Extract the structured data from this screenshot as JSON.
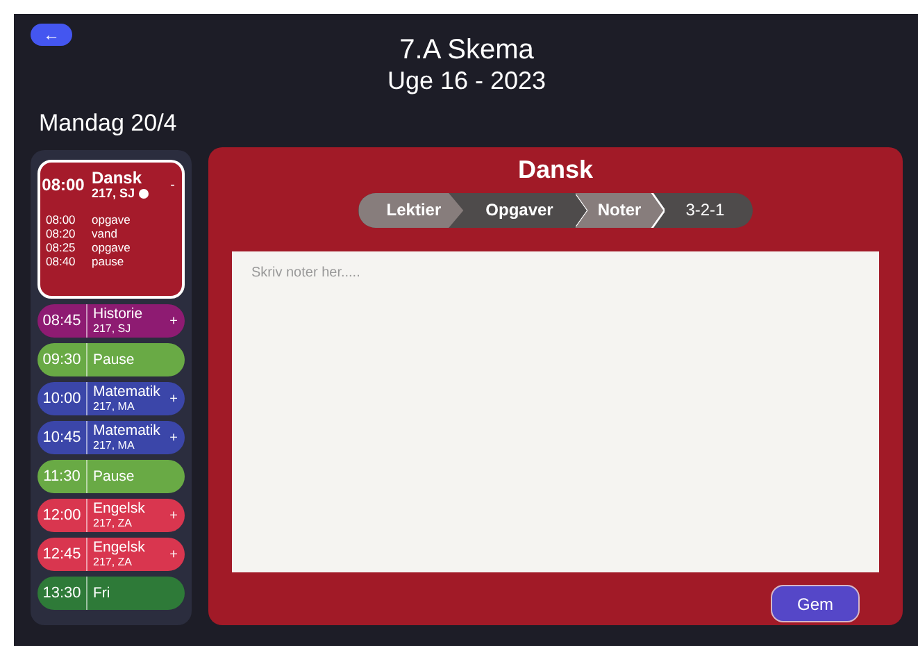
{
  "header": {
    "back_button": "←",
    "title": "7.A Skema",
    "subtitle": "Uge 16 - 2023"
  },
  "day": "Mandag 20/4",
  "schedule": [
    {
      "time": "08:00",
      "subject": "Dansk",
      "room": "217, SJ",
      "toggle": "-",
      "color": "#a51b2b",
      "expanded": true,
      "marked": true,
      "notes": [
        {
          "time": "08:00",
          "text": "opgave"
        },
        {
          "time": "08:20",
          "text": "vand"
        },
        {
          "time": "08:25",
          "text": "opgave"
        },
        {
          "time": "08:40",
          "text": "pause"
        }
      ]
    },
    {
      "time": "08:45",
      "subject": "Historie",
      "room": "217, SJ",
      "toggle": "+",
      "color": "#8e1b72",
      "expanded": false,
      "marked": false
    },
    {
      "time": "09:30",
      "subject": "Pause",
      "color": "#69aa45",
      "expanded": false,
      "marked": false
    },
    {
      "time": "10:00",
      "subject": "Matematik",
      "room": "217, MA",
      "toggle": "+",
      "color": "#3b46a9",
      "expanded": false,
      "marked": false
    },
    {
      "time": "10:45",
      "subject": "Matematik",
      "room": "217, MA",
      "toggle": "+",
      "color": "#3b46a9",
      "expanded": false,
      "marked": false
    },
    {
      "time": "11:30",
      "subject": "Pause",
      "color": "#69aa45",
      "expanded": false,
      "marked": false
    },
    {
      "time": "12:00",
      "subject": "Engelsk",
      "room": "217, ZA",
      "toggle": "+",
      "color": "#d9364f",
      "expanded": false,
      "marked": false
    },
    {
      "time": "12:45",
      "subject": "Engelsk",
      "room": "217, ZA",
      "toggle": "+",
      "color": "#d9364f",
      "expanded": false,
      "marked": false
    },
    {
      "time": "13:30",
      "subject": "Fri",
      "color": "#2e7a38",
      "expanded": false,
      "marked": false
    }
  ],
  "detail": {
    "title": "Dansk",
    "steps": [
      {
        "label": "Lektier",
        "highlighted": true,
        "selected": false
      },
      {
        "label": "Opgaver",
        "highlighted": false,
        "selected": false
      },
      {
        "label": "Noter",
        "highlighted": true,
        "selected": true
      },
      {
        "label": "3-2-1",
        "highlighted": false,
        "selected": false
      }
    ],
    "notes_field": {
      "placeholder": "Skriv noter her....."
    },
    "save_button": "Gem"
  }
}
